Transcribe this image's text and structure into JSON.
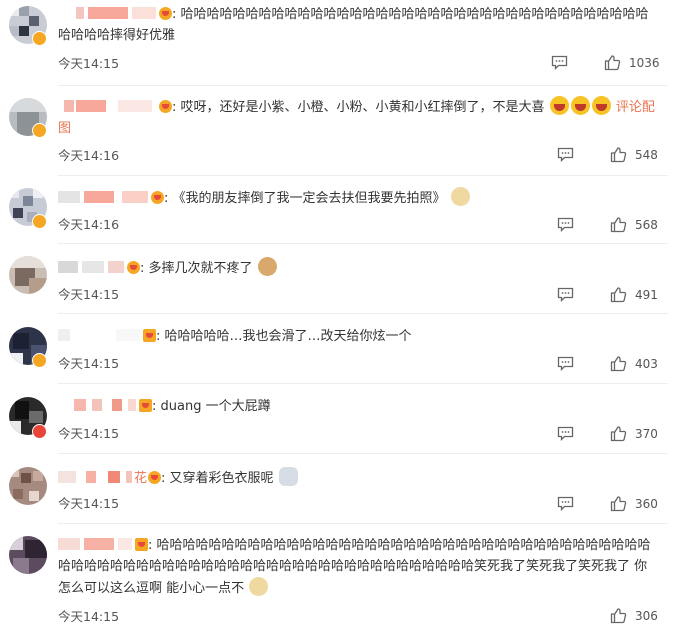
{
  "comments": [
    {
      "text": "哈哈哈哈哈哈哈哈哈哈哈哈哈哈哈哈哈哈哈哈哈哈哈哈哈哈哈哈哈哈哈哈哈哈哈哈哈哈哈哈摔得好优雅",
      "time": "今天14:15",
      "likes": "1036",
      "badge": "gold"
    },
    {
      "text": "哎呀，还好是小紫、小橙、小粉、小黄和小红摔倒了，不是大喜",
      "link1": "评论",
      "link2": "配图",
      "time": "今天14:16",
      "likes": "548",
      "badge": "gold"
    },
    {
      "text": "《我的朋友摔倒了我一定会去扶但我要先拍照》",
      "time": "今天14:16",
      "likes": "568",
      "badge": "gold"
    },
    {
      "text": "多摔几次就不疼了",
      "time": "今天14:15",
      "likes": "491",
      "badge": "none"
    },
    {
      "text": "哈哈哈哈哈…我也会滑了…改天给你炫一个",
      "time": "今天14:15",
      "likes": "403",
      "badge": "gold"
    },
    {
      "text": "duang 一个大屁蹲",
      "time": "今天14:15",
      "likes": "370",
      "badge": "red"
    },
    {
      "text": "又穿着彩色衣服呢",
      "name_suffix": "花",
      "time": "今天14:15",
      "likes": "360",
      "badge": "none"
    },
    {
      "text": "哈哈哈哈哈哈哈哈哈哈哈哈哈哈哈哈哈哈哈哈哈哈哈哈哈哈哈哈哈哈哈哈哈哈哈哈哈哈哈哈哈哈哈哈哈哈哈哈哈哈哈哈哈哈哈哈哈哈哈哈哈哈哈哈哈哈哈哈哈哈笑死我了笑死我了笑死我了 你怎么可以这么逗啊 能小心一点不",
      "time": "今天14:15",
      "likes": "306",
      "badge": "none"
    }
  ],
  "colors": {
    "accent": "#eb7350",
    "gold_badge": "#f5a623",
    "red_badge": "#e8443a"
  },
  "icons": {
    "comment": "comment-icon",
    "like": "thumbs-up-icon"
  }
}
